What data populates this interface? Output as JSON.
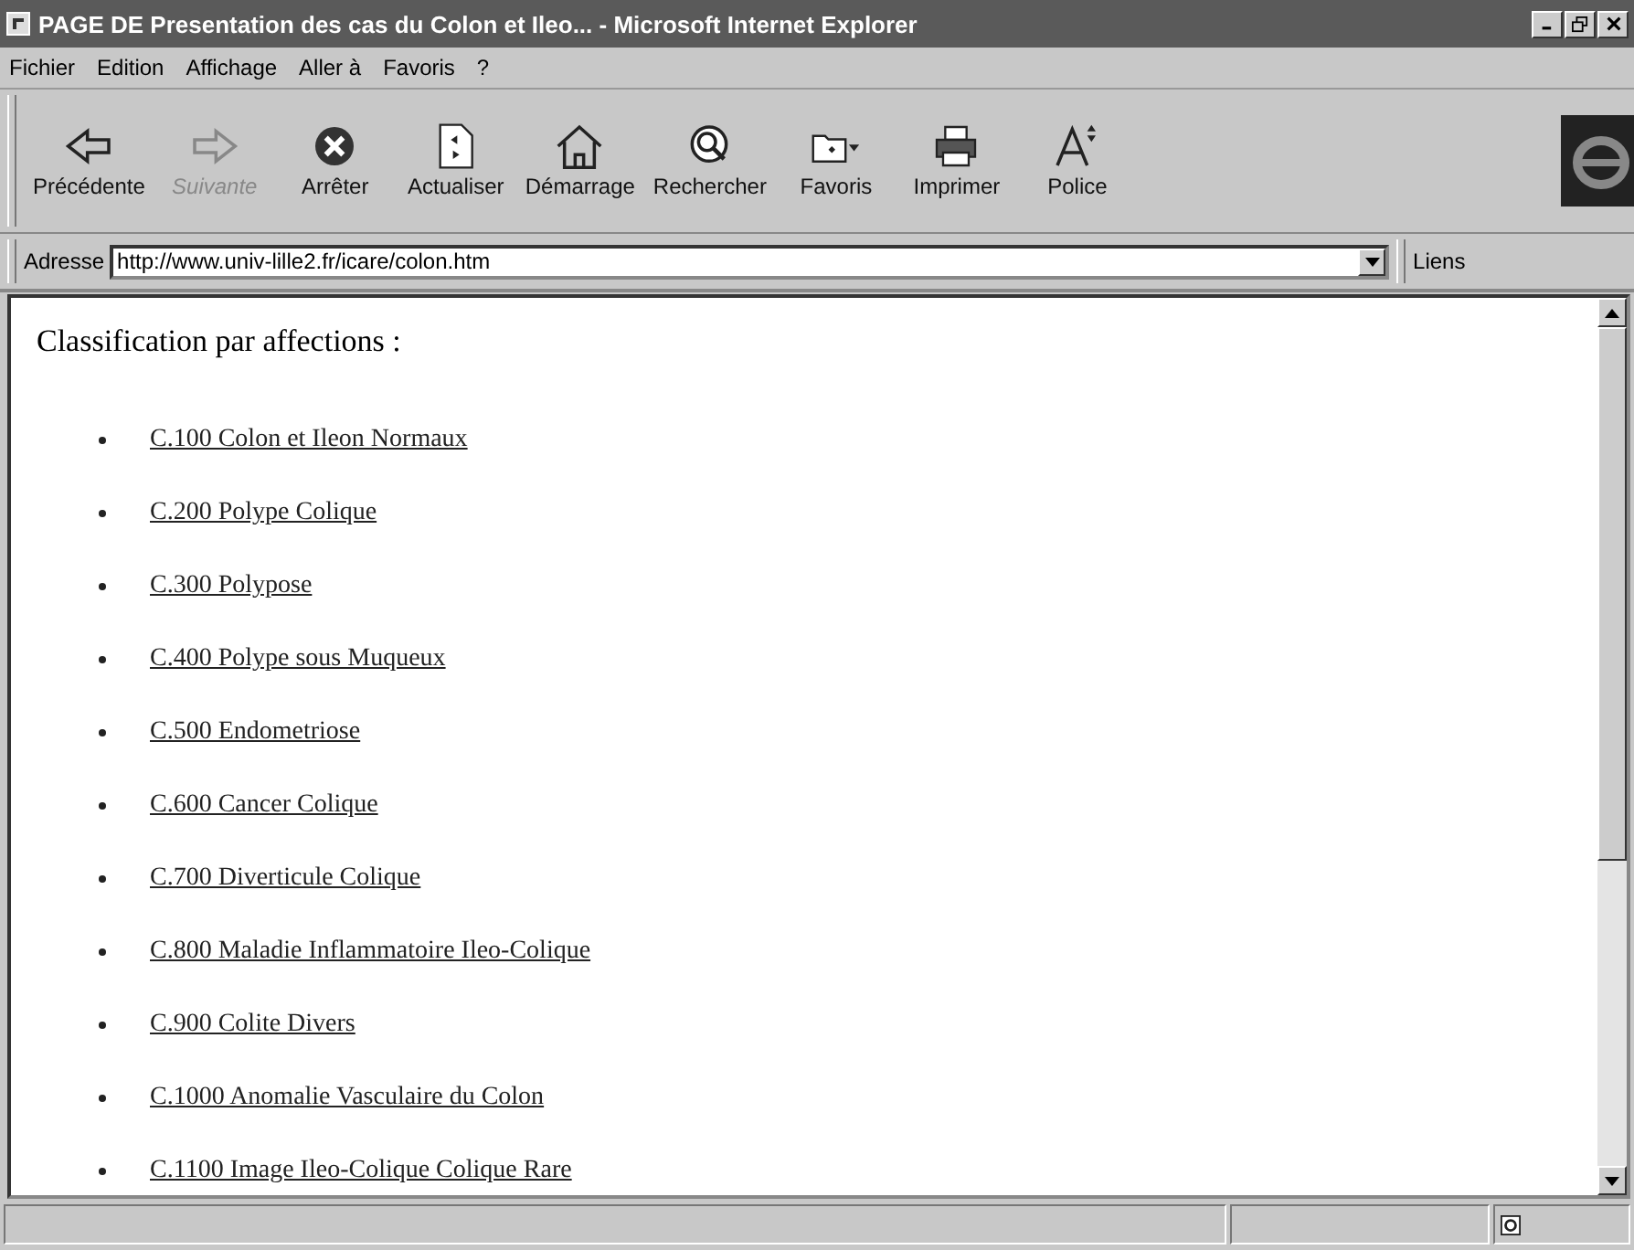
{
  "window": {
    "title": "PAGE DE Presentation des cas du Colon et Ileo... - Microsoft Internet Explorer"
  },
  "menu": [
    "Fichier",
    "Edition",
    "Affichage",
    "Aller à",
    "Favoris",
    "?"
  ],
  "toolbar": [
    {
      "label": "Précédente",
      "kind": "back",
      "disabled": false
    },
    {
      "label": "Suivante",
      "kind": "forward",
      "disabled": true
    },
    {
      "label": "Arrêter",
      "kind": "stop",
      "disabled": false
    },
    {
      "label": "Actualiser",
      "kind": "refresh",
      "disabled": false
    },
    {
      "label": "Démarrage",
      "kind": "home",
      "disabled": false
    },
    {
      "label": "Rechercher",
      "kind": "search",
      "disabled": false
    },
    {
      "label": "Favoris",
      "kind": "favorites",
      "disabled": false
    },
    {
      "label": "Imprimer",
      "kind": "print",
      "disabled": false
    },
    {
      "label": "Police",
      "kind": "font",
      "disabled": false
    }
  ],
  "address": {
    "label": "Adresse",
    "value": "http://www.univ-lille2.fr/icare/colon.htm",
    "links": "Liens"
  },
  "page": {
    "heading": "Classification par affections :",
    "links": [
      "C.100 Colon et Ileon Normaux",
      "C.200 Polype Colique",
      "C.300 Polypose",
      "C.400 Polype sous Muqueux",
      "C.500 Endometriose",
      "C.600 Cancer Colique",
      "C.700 Diverticule Colique",
      "C.800 Maladie Inflammatoire Ileo-Colique",
      "C.900 Colite Divers",
      "C.1000 Anomalie Vasculaire du Colon",
      "C.1100 Image Ileo-Colique Colique Rare"
    ]
  }
}
